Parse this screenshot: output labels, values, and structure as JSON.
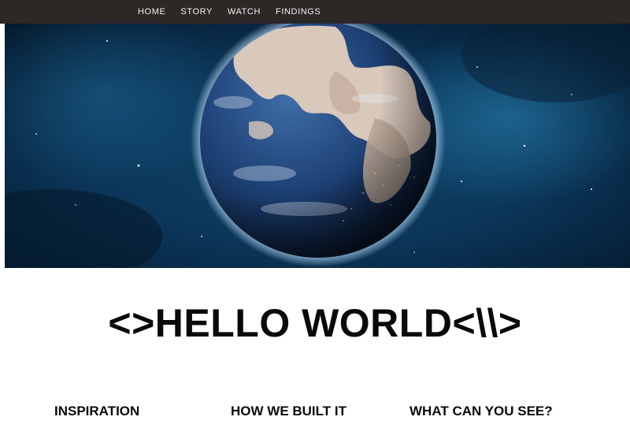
{
  "nav": {
    "items": [
      {
        "label": "HOME"
      },
      {
        "label": "STORY"
      },
      {
        "label": "WATCH"
      },
      {
        "label": "FINDINGS"
      }
    ],
    "background_color": "#2b2826",
    "text_color": "#f2f2f2"
  },
  "hero": {
    "image": "earth-from-space",
    "colors": {
      "space_dark": "#04182b",
      "space_light": "#1b6a9a",
      "ocean": "#1c3f73",
      "land": "#d9c8bc"
    }
  },
  "headline": {
    "text": "<>HELLO WORLD<\\\\>"
  },
  "sections": [
    {
      "heading": "INSPIRATION"
    },
    {
      "heading": "HOW WE BUILT IT"
    },
    {
      "heading": "WHAT CAN YOU SEE?"
    }
  ]
}
